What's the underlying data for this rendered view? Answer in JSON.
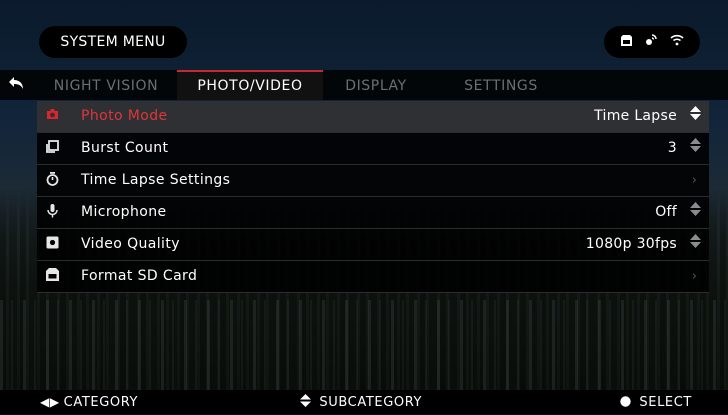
{
  "header": {
    "title": "SYSTEM MENU",
    "status_icons": [
      "sd-card-icon",
      "satellite-icon",
      "wifi-icon"
    ]
  },
  "tabs": [
    {
      "label": "NIGHT VISION",
      "active": false
    },
    {
      "label": "PHOTO/VIDEO",
      "active": true
    },
    {
      "label": "DISPLAY",
      "active": false
    },
    {
      "label": "SETTINGS",
      "active": false
    }
  ],
  "menu": {
    "items": [
      {
        "label": "Photo Mode",
        "value": "Time Lapse",
        "icon": "camera-icon",
        "control": "spinner",
        "selected": true
      },
      {
        "label": "Burst Count",
        "value": "3",
        "icon": "burst-icon",
        "control": "spinner",
        "selected": false
      },
      {
        "label": "Time Lapse Settings",
        "value": "",
        "icon": "timer-icon",
        "control": "chevron",
        "selected": false
      },
      {
        "label": "Microphone",
        "value": "Off",
        "icon": "microphone-icon",
        "control": "spinner",
        "selected": false
      },
      {
        "label": "Video Quality",
        "value": "1080p 30fps",
        "icon": "video-quality-icon",
        "control": "spinner",
        "selected": false
      },
      {
        "label": "Format SD Card",
        "value": "",
        "icon": "sd-card-icon",
        "control": "chevron",
        "selected": false
      }
    ]
  },
  "footer": {
    "category": "CATEGORY",
    "subcategory": "SUBCATEGORY",
    "select": "SELECT"
  },
  "colors": {
    "accent": "#d7262e",
    "inactive_tab": "#6b6f74",
    "row_bg": "#000000",
    "selected_row_bg": "#2e3033"
  }
}
